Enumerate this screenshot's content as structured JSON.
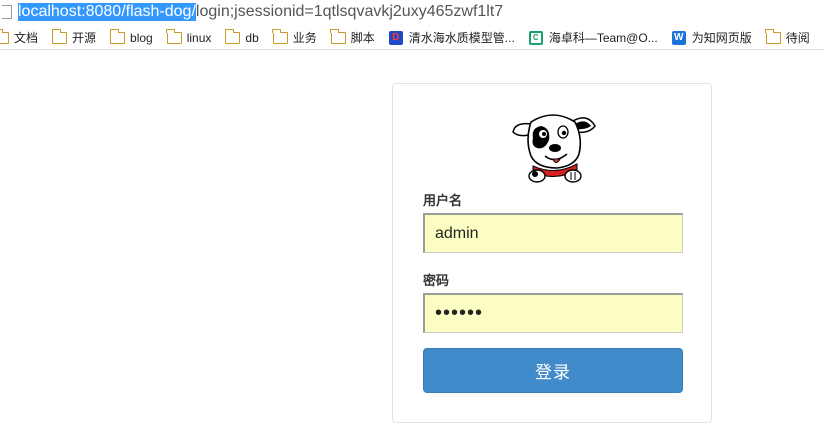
{
  "browser": {
    "url_selected": "localhost:8080/flash-dog/",
    "url_rest": "login;jsessionid=1qtlsqvavkj2uxy465zwf1lt7"
  },
  "bookmarks": [
    {
      "label": "文档",
      "icon": "folder-icon"
    },
    {
      "label": "开源",
      "icon": "folder-icon"
    },
    {
      "label": "blog",
      "icon": "folder-icon"
    },
    {
      "label": "linux",
      "icon": "folder-icon"
    },
    {
      "label": "db",
      "icon": "folder-icon"
    },
    {
      "label": "业务",
      "icon": "folder-icon"
    },
    {
      "label": "脚本",
      "icon": "folder-icon"
    },
    {
      "label": "清水海水质模型管...",
      "icon": "app-d-icon"
    },
    {
      "label": "海卓科—Team@O...",
      "icon": "app-c-icon"
    },
    {
      "label": "为知网页版",
      "icon": "app-w-icon"
    },
    {
      "label": "待阅",
      "icon": "folder-icon"
    }
  ],
  "login": {
    "logo_icon": "dog-mascot-logo",
    "username_label": "用户名",
    "username_value": "admin",
    "password_label": "密码",
    "password_value": "••••••",
    "submit_label": "登录"
  },
  "colors": {
    "input_bg": "#fbfdc3",
    "button_bg": "#428bca",
    "selection": "#3399ff"
  }
}
